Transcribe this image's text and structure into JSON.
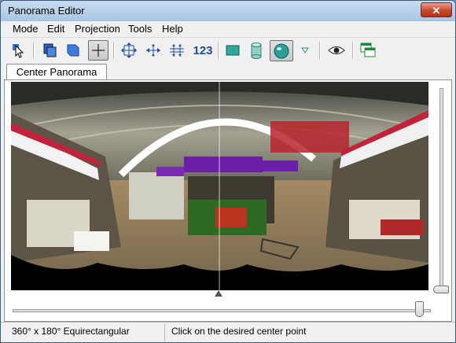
{
  "window": {
    "title": "Panorama Editor",
    "close_glyph": "✕"
  },
  "menu": {
    "items": [
      "Mode",
      "Edit",
      "Projection",
      "Tools",
      "Help"
    ]
  },
  "toolbar": {
    "buttons": [
      {
        "icon": "select-arrow-icon"
      },
      {
        "icon": "images-stack-icon"
      },
      {
        "icon": "blue-page-icon"
      },
      {
        "icon": "crosshair-icon",
        "active": true
      },
      {
        "icon": "move-all-icon"
      },
      {
        "icon": "pan-horizontal-icon"
      },
      {
        "icon": "stretch-vertical-icon"
      },
      {
        "icon": "numbers-icon",
        "label": "123"
      },
      {
        "icon": "rectilinear-projection-icon"
      },
      {
        "icon": "cylindrical-projection-icon"
      },
      {
        "icon": "spherical-projection-icon",
        "active": true
      },
      {
        "icon": "dropdown-triangle-icon"
      },
      {
        "icon": "eye-preview-icon"
      },
      {
        "icon": "windows-icon"
      }
    ]
  },
  "tabs": [
    {
      "label": "Center Panorama",
      "active": true
    }
  ],
  "sliders": {
    "vertical_position": 1.0,
    "horizontal_position": 0.985
  },
  "status": {
    "projection": "360° x 180° Equirectangular",
    "hint": "Click on the desired center point"
  },
  "colors": {
    "accent_purple": "#6b1fa8",
    "sign_text": "#ffe9ff",
    "ceiling": "#9a9a8a"
  }
}
